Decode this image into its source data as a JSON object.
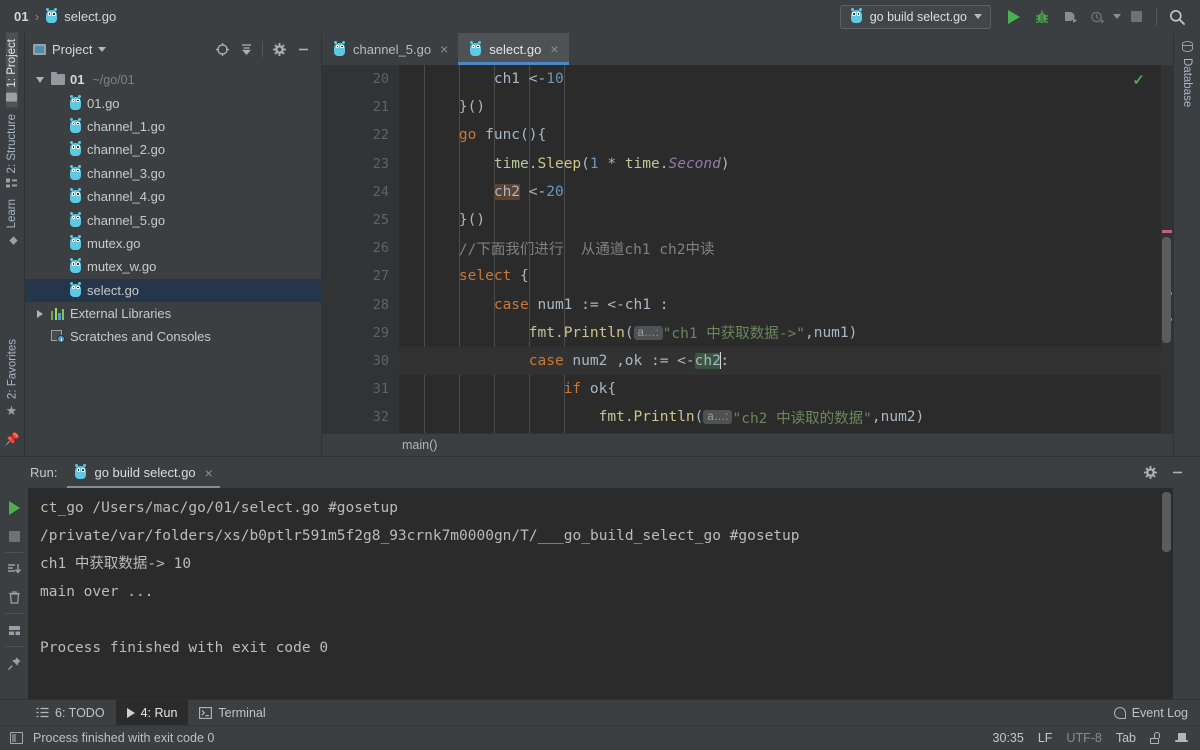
{
  "window": {
    "breadcrumb": {
      "project": "01",
      "separator": "›",
      "file": "select.go"
    }
  },
  "toolbar": {
    "run_config": {
      "label": "go build select.go",
      "icon": "gopher-run-icon"
    },
    "buttons": [
      {
        "name": "run-button",
        "icon": "play-icon",
        "color": "#4caf50"
      },
      {
        "name": "debug-button",
        "icon": "bug-icon",
        "color": "#4caf50"
      },
      {
        "name": "run-with-coverage-button",
        "icon": "coverage-icon"
      },
      {
        "name": "profile-button",
        "icon": "profiler-icon"
      },
      {
        "name": "stop-button",
        "icon": "stop-icon"
      },
      {
        "name": "search-everywhere-button",
        "icon": "search-icon"
      }
    ]
  },
  "left_strip": {
    "top": [
      {
        "label": "1: Project",
        "mnemonic": "1",
        "icon": "folder-icon",
        "active": true
      },
      {
        "label": "2: Structure",
        "mnemonic": "2",
        "icon": "structure-icon",
        "active": false
      },
      {
        "label": "Learn",
        "mnemonic": "",
        "icon": "learn-icon",
        "active": false
      }
    ],
    "bottom": [
      {
        "label": "2: Favorites",
        "mnemonic": "2",
        "icon": "star-icon",
        "active": false
      },
      {
        "label": "",
        "mnemonic": "",
        "icon": "pin-icon",
        "active": false
      }
    ]
  },
  "right_strip": {
    "tabs": [
      {
        "label": "Database",
        "icon": "database-icon"
      }
    ]
  },
  "project_panel": {
    "title": "Project",
    "header_icons": [
      {
        "name": "select-opened-file-icon"
      },
      {
        "name": "collapse-all-icon"
      },
      {
        "name": "gear-icon"
      },
      {
        "name": "hide-panel-icon"
      }
    ],
    "tree": [
      {
        "id": "root",
        "label": "01",
        "path": "~/go/01",
        "icon": "folder-icon",
        "arrow": "down",
        "indent": 0,
        "bold": true,
        "selected": false
      },
      {
        "id": "f1",
        "label": "01.go",
        "path": "",
        "icon": "go-file-icon",
        "arrow": "",
        "indent": 1,
        "bold": false,
        "selected": false
      },
      {
        "id": "f2",
        "label": "channel_1.go",
        "path": "",
        "icon": "go-file-icon",
        "arrow": "",
        "indent": 1,
        "bold": false,
        "selected": false
      },
      {
        "id": "f3",
        "label": "channel_2.go",
        "path": "",
        "icon": "go-file-icon",
        "arrow": "",
        "indent": 1,
        "bold": false,
        "selected": false
      },
      {
        "id": "f4",
        "label": "channel_3.go",
        "path": "",
        "icon": "go-file-icon",
        "arrow": "",
        "indent": 1,
        "bold": false,
        "selected": false
      },
      {
        "id": "f5",
        "label": "channel_4.go",
        "path": "",
        "icon": "go-file-icon",
        "arrow": "",
        "indent": 1,
        "bold": false,
        "selected": false
      },
      {
        "id": "f6",
        "label": "channel_5.go",
        "path": "",
        "icon": "go-file-icon",
        "arrow": "",
        "indent": 1,
        "bold": false,
        "selected": false
      },
      {
        "id": "f7",
        "label": "mutex.go",
        "path": "",
        "icon": "go-file-icon",
        "arrow": "",
        "indent": 1,
        "bold": false,
        "selected": false
      },
      {
        "id": "f8",
        "label": "mutex_w.go",
        "path": "",
        "icon": "go-file-icon",
        "arrow": "",
        "indent": 1,
        "bold": false,
        "selected": false
      },
      {
        "id": "f9",
        "label": "select.go",
        "path": "",
        "icon": "go-file-icon",
        "arrow": "",
        "indent": 1,
        "bold": false,
        "selected": true
      },
      {
        "id": "ext",
        "label": "External Libraries",
        "path": "",
        "icon": "libraries-icon",
        "arrow": "right",
        "indent": 0,
        "bold": false,
        "selected": false
      },
      {
        "id": "scr",
        "label": "Scratches and Consoles",
        "path": "",
        "icon": "scratches-icon",
        "arrow": "",
        "indent": 0,
        "bold": false,
        "selected": false
      }
    ]
  },
  "editor": {
    "tabs": [
      {
        "label": "channel_5.go",
        "icon": "go-file-icon",
        "active": false,
        "close": "×"
      },
      {
        "label": "select.go",
        "icon": "go-file-icon",
        "active": true,
        "close": "×"
      }
    ],
    "breadcrumb": "main()",
    "inspection_status": "✓",
    "lines": [
      {
        "n": "20",
        "fold": "",
        "caret": false
      },
      {
        "n": "21",
        "fold": "end",
        "caret": false
      },
      {
        "n": "22",
        "fold": "start",
        "caret": false
      },
      {
        "n": "23",
        "fold": "",
        "caret": false
      },
      {
        "n": "24",
        "fold": "",
        "caret": false
      },
      {
        "n": "25",
        "fold": "end",
        "caret": false
      },
      {
        "n": "26",
        "fold": "",
        "caret": false
      },
      {
        "n": "27",
        "fold": "start",
        "caret": false
      },
      {
        "n": "28",
        "fold": "start",
        "caret": false
      },
      {
        "n": "29",
        "fold": "end",
        "caret": false
      },
      {
        "n": "30",
        "fold": "start",
        "caret": true
      },
      {
        "n": "31",
        "fold": "start",
        "caret": false
      },
      {
        "n": "32",
        "fold": "",
        "caret": false
      }
    ],
    "code": {
      "l20": {
        "indent": "        ",
        "a": "ch1 <-",
        "num": "10"
      },
      "l21": "    }()",
      "l22": {
        "kw": "go",
        "rest": " func(){"
      },
      "l23": {
        "indent": "        ",
        "pkg": "time",
        "dot1": ".",
        "fn": "Sleep",
        "p1": "(",
        "num": "1",
        "op": " * ",
        "pkg2": "time",
        "dot2": ".",
        "ital": "Second",
        "p2": ")"
      },
      "l24": {
        "indent": "        ",
        "hl": "ch2",
        "mid": " <-",
        "num": "20"
      },
      "l25": "    }()",
      "l26": "    //下面我们进行  从通道ch1 ch2中读",
      "l27": {
        "kw": "select",
        "rest": " {"
      },
      "l28": {
        "kw": "case",
        "rest": " num1 := <-ch1 :"
      },
      "l29": {
        "pkg": "fmt",
        "dot": ".",
        "fn": "Println",
        "p1": "(",
        "hint": "a…:",
        "str": "\"ch1 中获取数据->\"",
        "tail": ",num1)"
      },
      "l30": {
        "kw": "case",
        "mid": " num2 ,ok := <-",
        "hl": "ch2",
        "tail": ":"
      },
      "l31": {
        "kw": "if",
        "rest": " ok{"
      },
      "l32": {
        "pkg": "fmt",
        "dot": ".",
        "fn": "Println",
        "p1": "(",
        "hint": "a…:",
        "str": "\"ch2 中读取的数据\"",
        "tail": ",num2)"
      }
    }
  },
  "run_panel": {
    "label": "Run:",
    "tab": {
      "label": "go build select.go",
      "icon": "gopher-run-icon",
      "close": "×"
    },
    "header_icons": [
      {
        "name": "gear-icon"
      },
      {
        "name": "hide-panel-icon"
      }
    ],
    "toolbar_icons": [
      {
        "name": "rerun-button",
        "icon": "play-icon"
      },
      {
        "name": "stop-button",
        "icon": "stop-icon"
      },
      {
        "name": "scroll-to-end-button",
        "icon": "scroll-end-icon"
      },
      {
        "name": "clear-all-button",
        "icon": "trash-icon"
      },
      {
        "name": "soft-wrap-button",
        "icon": "wrap-icon"
      },
      {
        "name": "pin-tab-button",
        "icon": "pin-icon"
      }
    ],
    "console_lines": [
      "ct_go /Users/mac/go/01/select.go #gosetup",
      "/private/var/folders/xs/b0ptlr591m5f2g8_93crnk7m0000gn/T/___go_build_select_go #gosetup",
      "ch1 中获取数据-> 10",
      "main over ...",
      "",
      "Process finished with exit code 0"
    ]
  },
  "bottom_tabs": {
    "items": [
      {
        "label": "6: TODO",
        "mnemonic": "6",
        "icon": "todo-icon",
        "active": false
      },
      {
        "label": "4: Run",
        "mnemonic": "4",
        "icon": "play-icon",
        "active": true
      },
      {
        "label": "Terminal",
        "mnemonic": "",
        "icon": "terminal-icon",
        "active": false
      }
    ],
    "event_log": "Event Log"
  },
  "status_bar": {
    "message": "Process finished with exit code 0",
    "caret_position": "30:35",
    "line_separator": "LF",
    "encoding": "UTF-8",
    "indent": "Tab",
    "icons": [
      {
        "name": "lock-icon"
      },
      {
        "name": "powersave-icon"
      }
    ]
  },
  "colors": {
    "accent_blue": "#4a88c7",
    "selection": "#26364a",
    "run_green": "#4caf50",
    "editor_bg": "#2b2b2b",
    "panel_bg": "#3c3f41"
  }
}
